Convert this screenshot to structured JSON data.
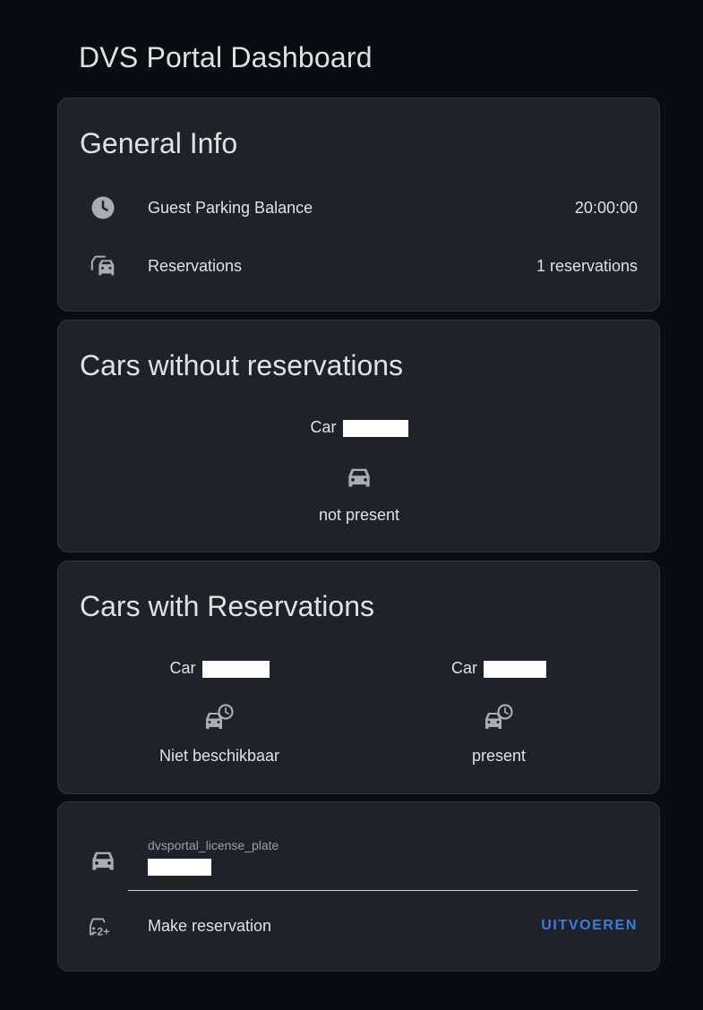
{
  "page": {
    "title": "DVS Portal Dashboard"
  },
  "general_info": {
    "title": "General Info",
    "rows": [
      {
        "icon": "clock-icon",
        "label": "Guest Parking Balance",
        "value": "20:00:00"
      },
      {
        "icon": "car-multiple-icon",
        "label": "Reservations",
        "value": "1 reservations"
      }
    ]
  },
  "cars_without_reservations": {
    "title": "Cars without reservations",
    "cars": [
      {
        "name": "Car",
        "icon": "car-icon",
        "state": "not present"
      }
    ]
  },
  "cars_with_reservations": {
    "title": "Cars with Reservations",
    "cars": [
      {
        "name": "Car",
        "icon": "car-clock-icon",
        "state": "Niet beschikbaar"
      },
      {
        "name": "Car",
        "icon": "car-clock-icon",
        "state": "present"
      }
    ]
  },
  "reservation_form": {
    "plate_field_caption": "dvsportal_license_plate",
    "plate_field_icon": "car-icon",
    "action_icon": "car-plus-icon",
    "action_label": "Make reservation",
    "action_button": "UITVOEREN"
  },
  "colors": {
    "background": "#090c12",
    "card": "#1f2329",
    "text": "#e1e1e1",
    "icon": "#a9acb1",
    "accent": "#3c7be0"
  }
}
